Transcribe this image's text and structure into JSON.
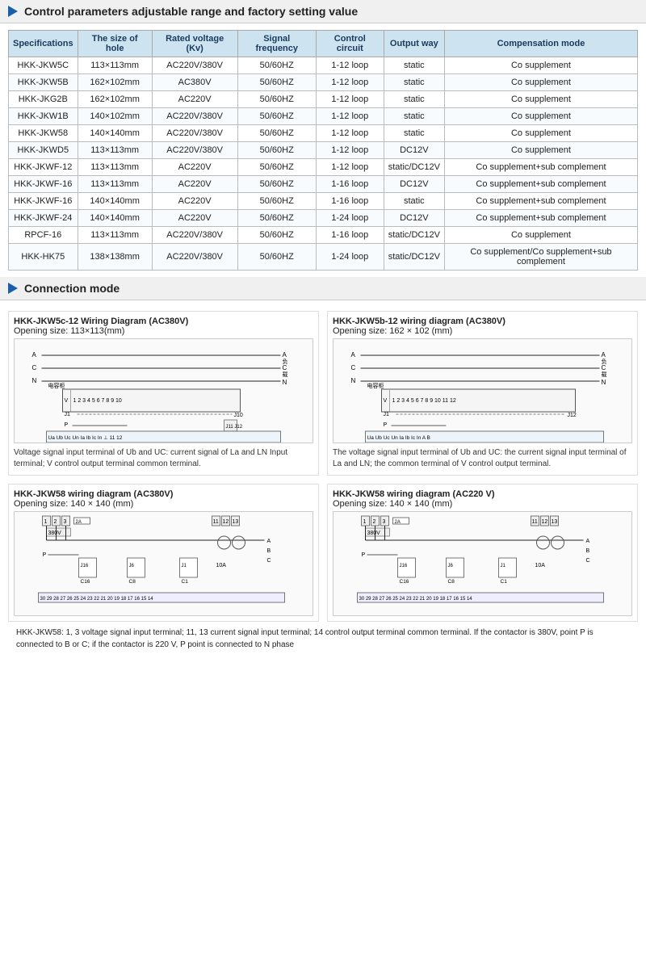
{
  "section1": {
    "title": "Control parameters adjustable range and factory setting value",
    "columns": [
      "Specifications",
      "The size of hole",
      "Rated voltage (Kv)",
      "Signal frequency",
      "Control circuit",
      "Output way",
      "Compensation mode"
    ],
    "rows": [
      [
        "HKK-JKW5C",
        "113×113mm",
        "AC220V/380V",
        "50/60HZ",
        "1-12 loop",
        "static",
        "Co supplement"
      ],
      [
        "HKK-JKW5B",
        "162×102mm",
        "AC380V",
        "50/60HZ",
        "1-12 loop",
        "static",
        "Co supplement"
      ],
      [
        "HKK-JKG2B",
        "162×102mm",
        "AC220V",
        "50/60HZ",
        "1-12 loop",
        "static",
        "Co supplement"
      ],
      [
        "HKK-JKW1B",
        "140×102mm",
        "AC220V/380V",
        "50/60HZ",
        "1-12 loop",
        "static",
        "Co supplement"
      ],
      [
        "HKK-JKW58",
        "140×140mm",
        "AC220V/380V",
        "50/60HZ",
        "1-12 loop",
        "static",
        "Co supplement"
      ],
      [
        "HKK-JKWD5",
        "113×113mm",
        "AC220V/380V",
        "50/60HZ",
        "1-12 loop",
        "DC12V",
        "Co supplement"
      ],
      [
        "HKK-JKWF-12",
        "113×113mm",
        "AC220V",
        "50/60HZ",
        "1-12 loop",
        "static/DC12V",
        "Co supplement+sub complement"
      ],
      [
        "HKK-JKWF-16",
        "113×113mm",
        "AC220V",
        "50/60HZ",
        "1-16 loop",
        "DC12V",
        "Co supplement+sub complement"
      ],
      [
        "HKK-JKWF-16",
        "140×140mm",
        "AC220V",
        "50/60HZ",
        "1-16 loop",
        "static",
        "Co supplement+sub complement"
      ],
      [
        "HKK-JKWF-24",
        "140×140mm",
        "AC220V",
        "50/60HZ",
        "1-24 loop",
        "DC12V",
        "Co supplement+sub complement"
      ],
      [
        "RPCF-16",
        "113×113mm",
        "AC220V/380V",
        "50/60HZ",
        "1-16 loop",
        "static/DC12V",
        "Co supplement"
      ],
      [
        "HKK-HK75",
        "138×138mm",
        "AC220V/380V",
        "50/60HZ",
        "1-24 loop",
        "static/DC12V",
        "Co supplement/Co supplement+sub complement"
      ]
    ]
  },
  "section2": {
    "title": "Connection mode",
    "wirings": [
      {
        "title": "HKK-JKW5c-12 Wiring Diagram (AC380V)",
        "subtitle": "Opening size: 113×113(mm)",
        "description": "Voltage signal input terminal of Ub and UC: current signal of La and LN Input terminal; V control output terminal common terminal."
      },
      {
        "title": "HKK-JKW5b-12 wiring diagram (AC380V)",
        "subtitle": "Opening size: 162 × 102 (mm)",
        "description": "The voltage signal input terminal of Ub and UC: the current signal input terminal of La and LN; the common terminal of V control output terminal."
      },
      {
        "title": "HKK-JKW58 wiring diagram (AC380V)",
        "subtitle": "Opening size: 140 × 140 (mm)",
        "description": ""
      },
      {
        "title": "HKK-JKW58 wiring diagram (AC220 V)",
        "subtitle": "Opening size: 140 × 140 (mm)",
        "description": ""
      }
    ],
    "bottom_note": "HKK-JKW58: 1, 3 voltage signal input terminal; 11, 13 current signal input terminal; 14 control output terminal common terminal. If the contactor is 380V, point P is connected to B or C; if the contactor is 220 V, P point is connected to N phase"
  }
}
